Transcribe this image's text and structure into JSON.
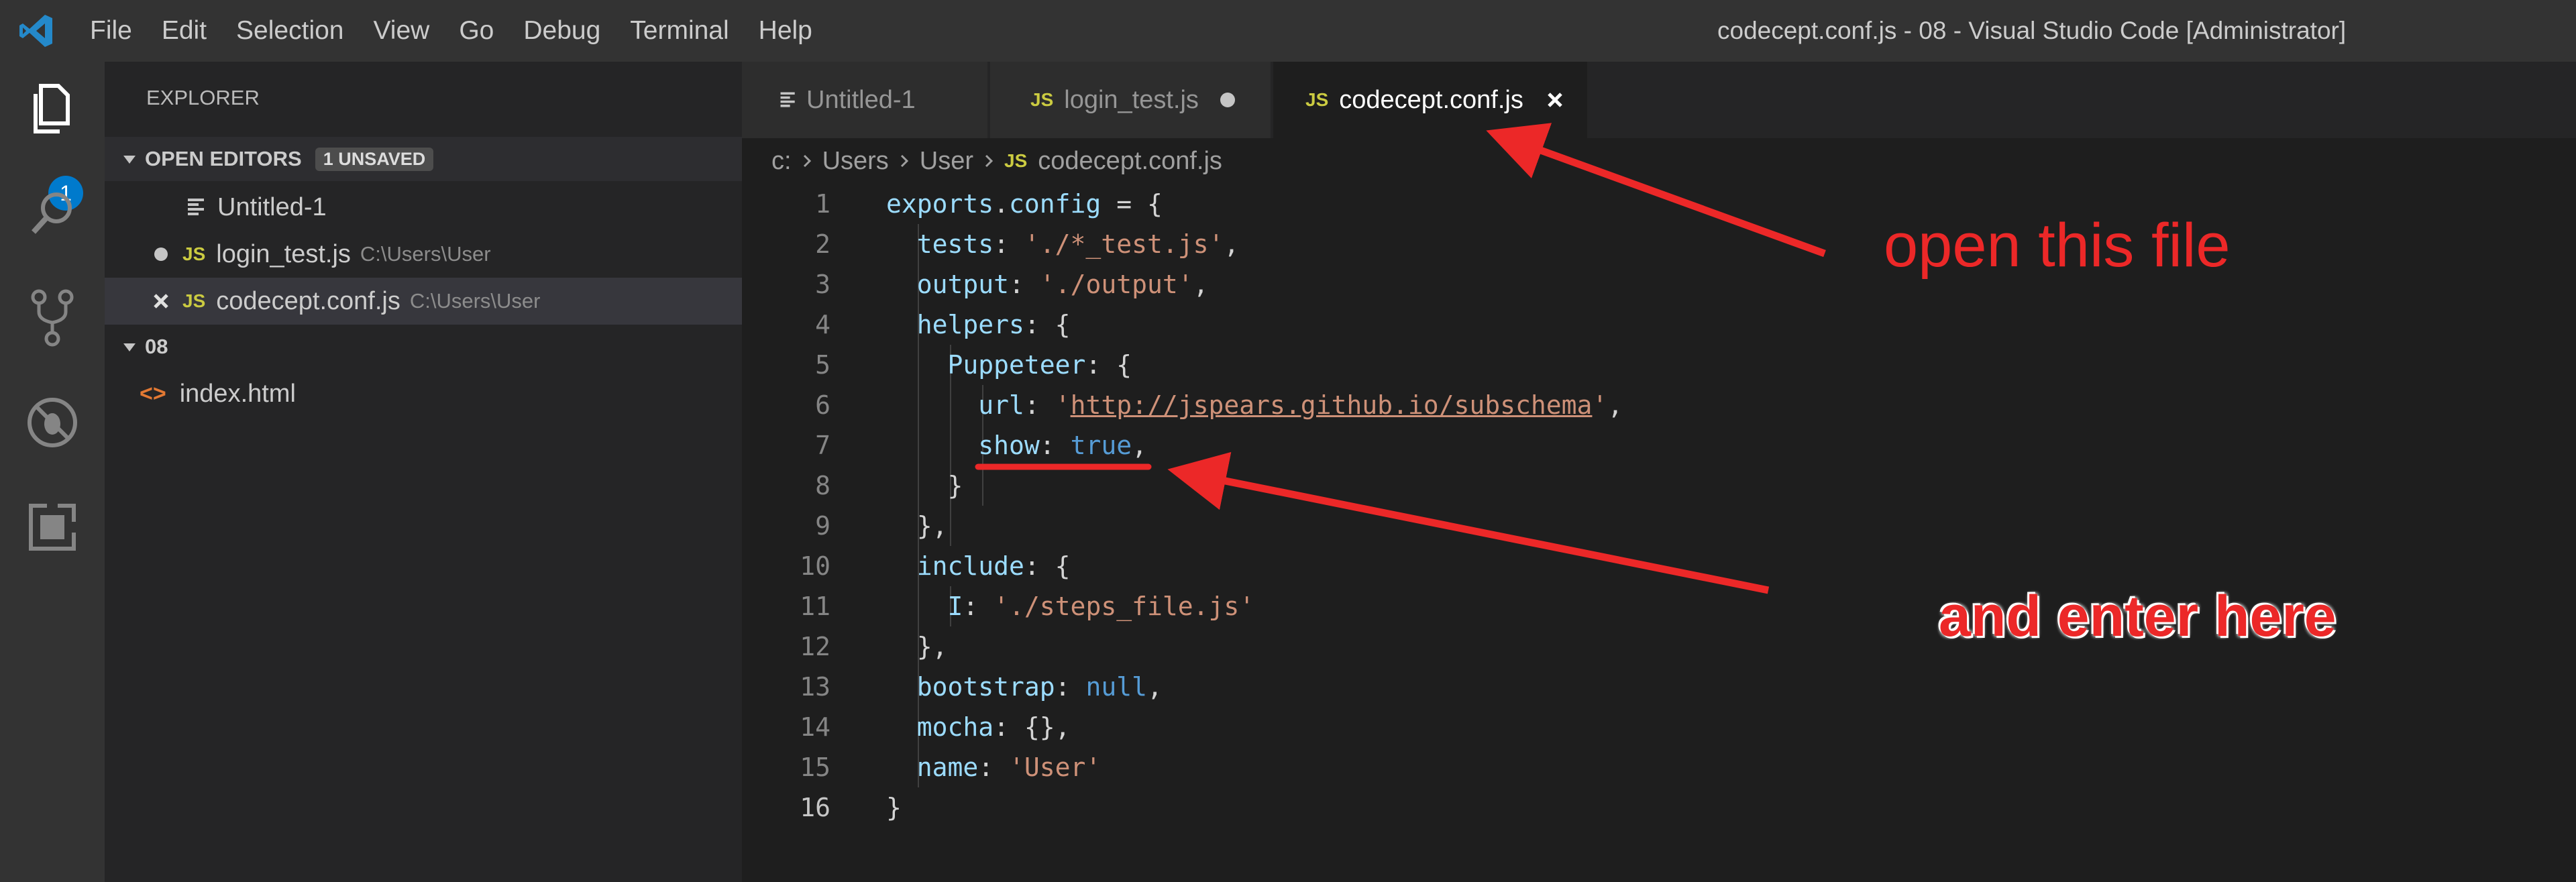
{
  "menu": [
    "File",
    "Edit",
    "Selection",
    "View",
    "Go",
    "Debug",
    "Terminal",
    "Help"
  ],
  "window_title": "codecept.conf.js - 08 - Visual Studio Code [Administrator]",
  "activity": {
    "explorer_badge": "1"
  },
  "sidebar": {
    "title": "EXPLORER",
    "open_editors": {
      "label": "OPEN EDITORS",
      "badge": "1 UNSAVED",
      "items": [
        {
          "name": "Untitled-1",
          "path": ""
        },
        {
          "name": "login_test.js",
          "path": "C:\\Users\\User"
        },
        {
          "name": "codecept.conf.js",
          "path": "C:\\Users\\User"
        }
      ]
    },
    "folder": {
      "label": "08",
      "items": [
        {
          "name": "index.html"
        }
      ]
    }
  },
  "tabs": [
    {
      "label": "Untitled-1",
      "icon": "file-lines-icon"
    },
    {
      "label": "login_test.js",
      "icon": "js-icon",
      "modified": true
    },
    {
      "label": "codecept.conf.js",
      "icon": "js-icon",
      "active": true
    }
  ],
  "breadcrumb": {
    "drive": "c:",
    "parts": [
      "Users",
      "User"
    ],
    "file": "codecept.conf.js"
  },
  "editor": {
    "line_numbers": [
      "1",
      "2",
      "3",
      "4",
      "5",
      "6",
      "7",
      "8",
      "9",
      "10",
      "11",
      "12",
      "13",
      "14",
      "15",
      "16"
    ],
    "current_line": 16,
    "lines": [
      "exports.config = {",
      "  tests: './*_test.js',",
      "  output: './output',",
      "  helpers: {",
      "    Puppeteer: {",
      "      url: 'http://jspears.github.io/subschema',",
      "      show: true,",
      "    }",
      "  },",
      "  include: {",
      "    I: './steps_file.js'",
      "  },",
      "  bootstrap: null,",
      "  mocha: {},",
      "  name: 'User'",
      "}"
    ]
  },
  "annotations": {
    "open_file": "open this file",
    "enter_here": "and enter here"
  },
  "colors": {
    "accent": "#007acc",
    "annotation_red": "#ec2828",
    "js_yellow": "#cbcb41"
  }
}
